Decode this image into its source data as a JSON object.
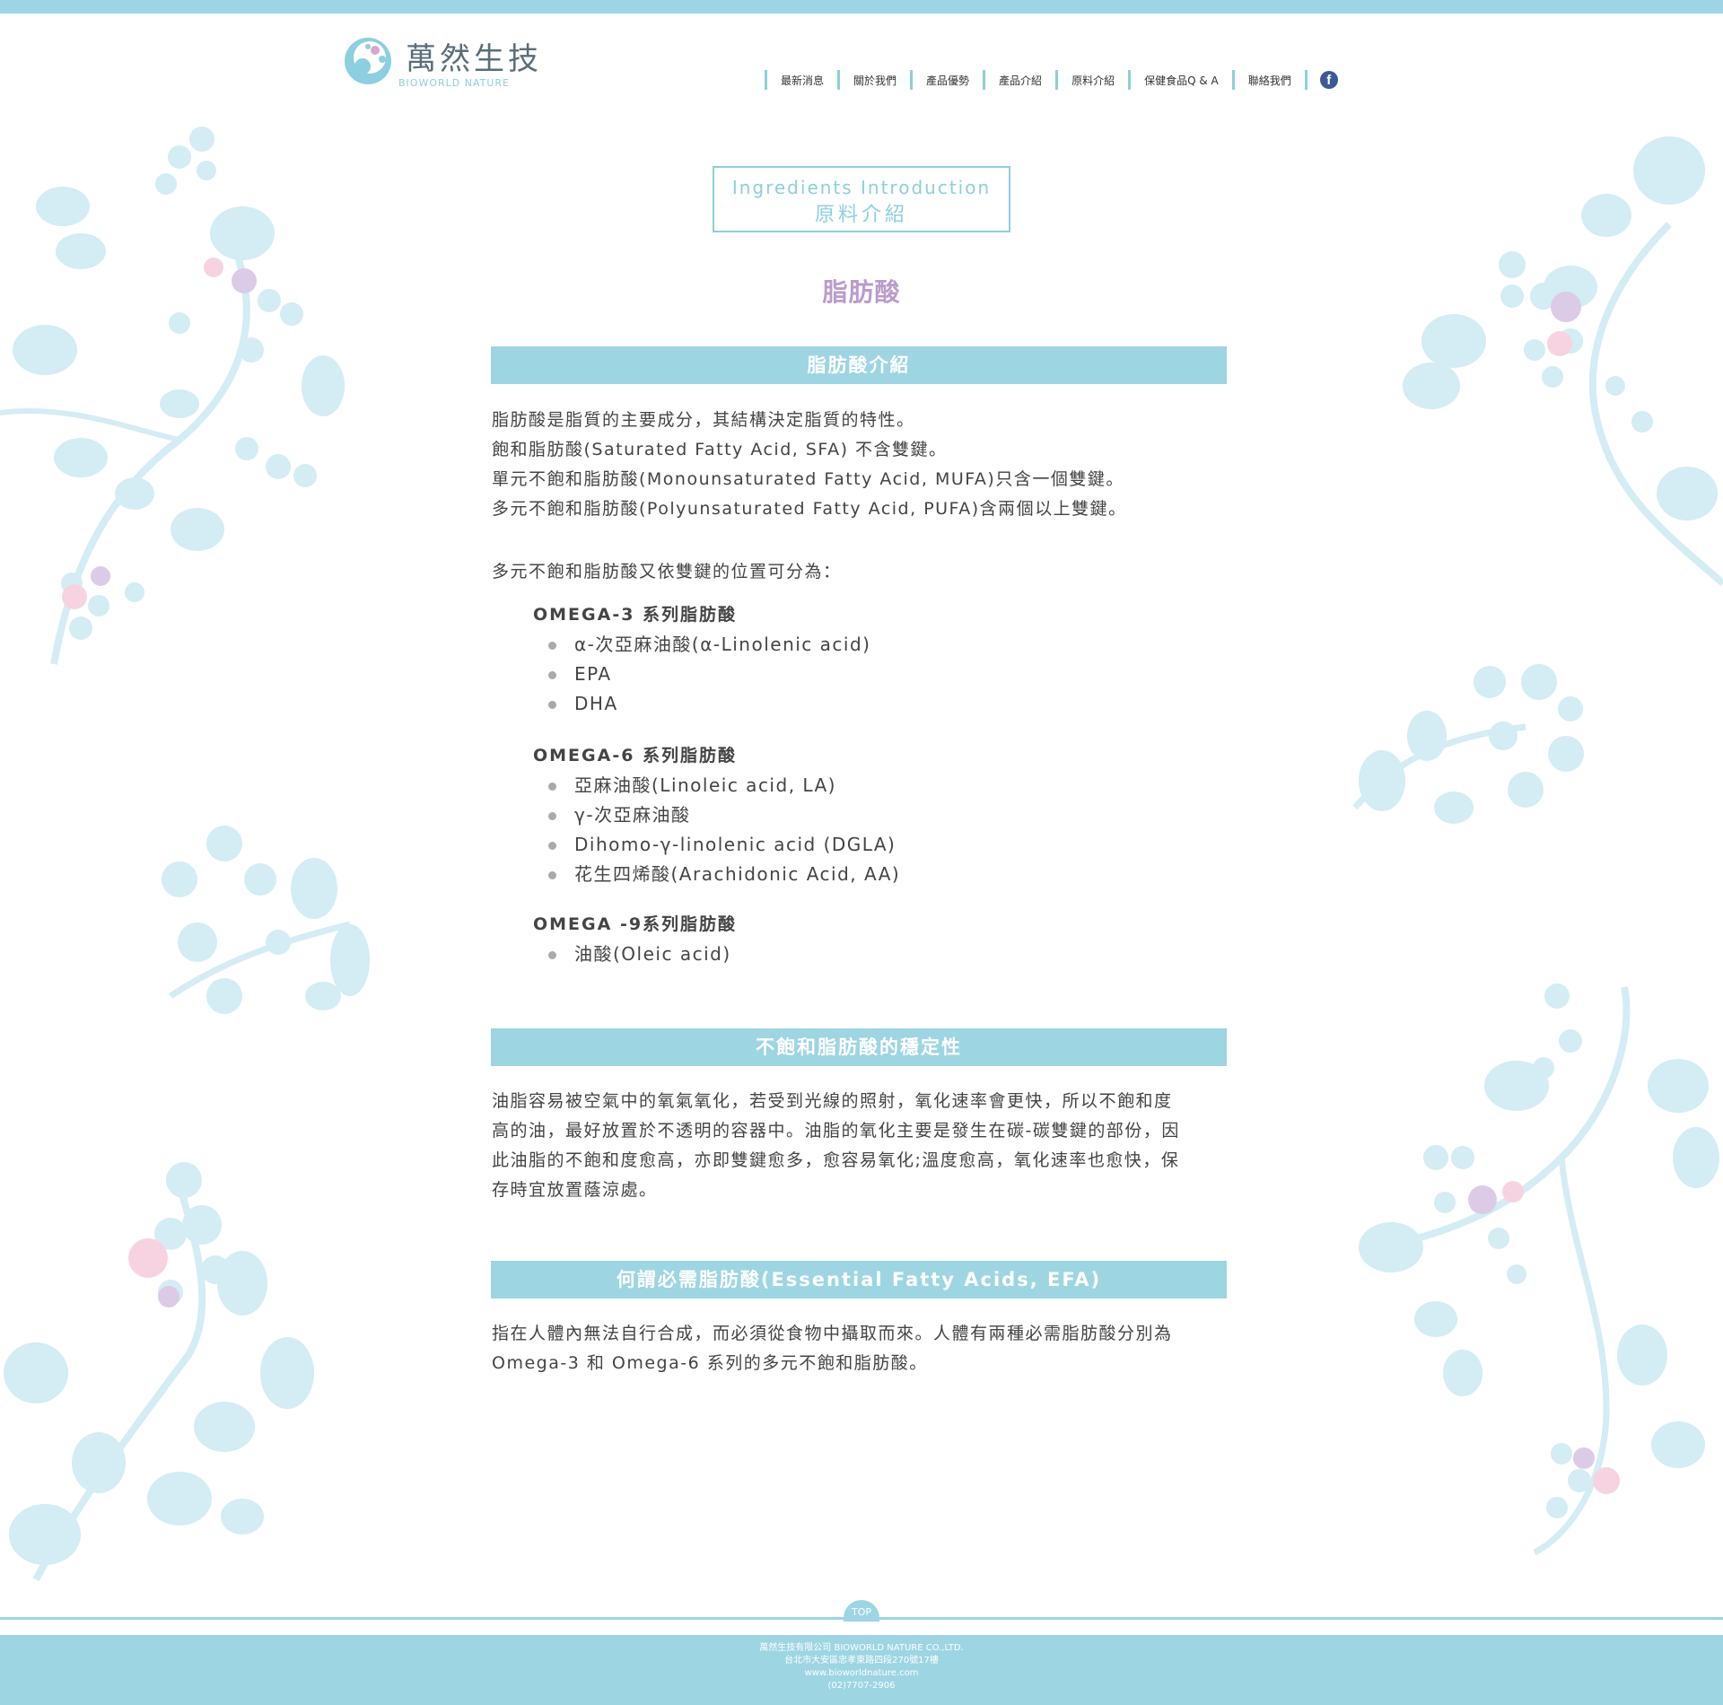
{
  "brand": {
    "name_cn": "萬然生技",
    "name_en": "BIOWORLD NATURE"
  },
  "nav": {
    "items": [
      "最新消息",
      "關於我們",
      "產品優勢",
      "產品介紹",
      "原料介紹",
      "保健食品Q & A",
      "聯絡我們"
    ],
    "facebook_icon": "facebook-icon"
  },
  "page_title": {
    "en": "Ingredients Introduction",
    "cn": "原料介紹"
  },
  "main_heading": "脂肪酸",
  "sections": {
    "intro": {
      "title": "脂肪酸介紹",
      "lines": [
        "脂肪酸是脂質的主要成分，其結構決定脂質的特性。",
        "飽和脂肪酸(Saturated Fatty Acid, SFA) 不含雙鍵。",
        "單元不飽和脂肪酸(Monounsaturated Fatty Acid, MUFA)只含一個雙鍵。",
        "多元不飽和脂肪酸(Polyunsaturated Fatty Acid, PUFA)含兩個以上雙鍵。"
      ],
      "classify": "多元不飽和脂肪酸又依雙鍵的位置可分為：",
      "groups": [
        {
          "head": "OMEGA-3 系列脂肪酸",
          "items": [
            "α-次亞麻油酸(α-Linolenic acid)",
            "EPA",
            "DHA"
          ]
        },
        {
          "head": "OMEGA-6 系列脂肪酸",
          "items": [
            "亞麻油酸(Linoleic acid, LA)",
            "γ-次亞麻油酸",
            "Dihomo-γ-linolenic acid (DGLA)",
            "花生四烯酸(Arachidonic Acid, AA)"
          ]
        },
        {
          "head": "OMEGA -9系列脂肪酸",
          "items": [
            "油酸(Oleic acid)"
          ]
        }
      ]
    },
    "stability": {
      "title": "不飽和脂肪酸的穩定性",
      "lines": [
        "油脂容易被空氣中的氧氣氧化，若受到光線的照射，氧化速率會更快，所以不飽和度",
        "高的油，最好放置於不透明的容器中。油脂的氧化主要是發生在碳-碳雙鍵的部份，因",
        "此油脂的不飽和度愈高，亦即雙鍵愈多，愈容易氧化;溫度愈高，氧化速率也愈快，保",
        "存時宜放置蔭涼處。"
      ]
    },
    "efa": {
      "title": "何謂必需脂肪酸(Essential Fatty Acids, EFA)",
      "lines": [
        "指在人體內無法自行合成，而必須從食物中攝取而來。人體有兩種必需脂肪酸分別為",
        "Omega-3 和 Omega-6 系列的多元不飽和脂肪酸。"
      ]
    }
  },
  "top_button": "TOP",
  "footer": {
    "company": "萬然生技有限公司 BIOWORLD NATURE CO.,LTD.",
    "address": "台北市大安區忠孝東路四段270號17樓",
    "website": "www.bioworldnature.com",
    "phone": "(02)7707-2906"
  },
  "colors": {
    "accent": "#9dd5e3",
    "heading_purple": "#b89ccb",
    "text": "#444444"
  }
}
